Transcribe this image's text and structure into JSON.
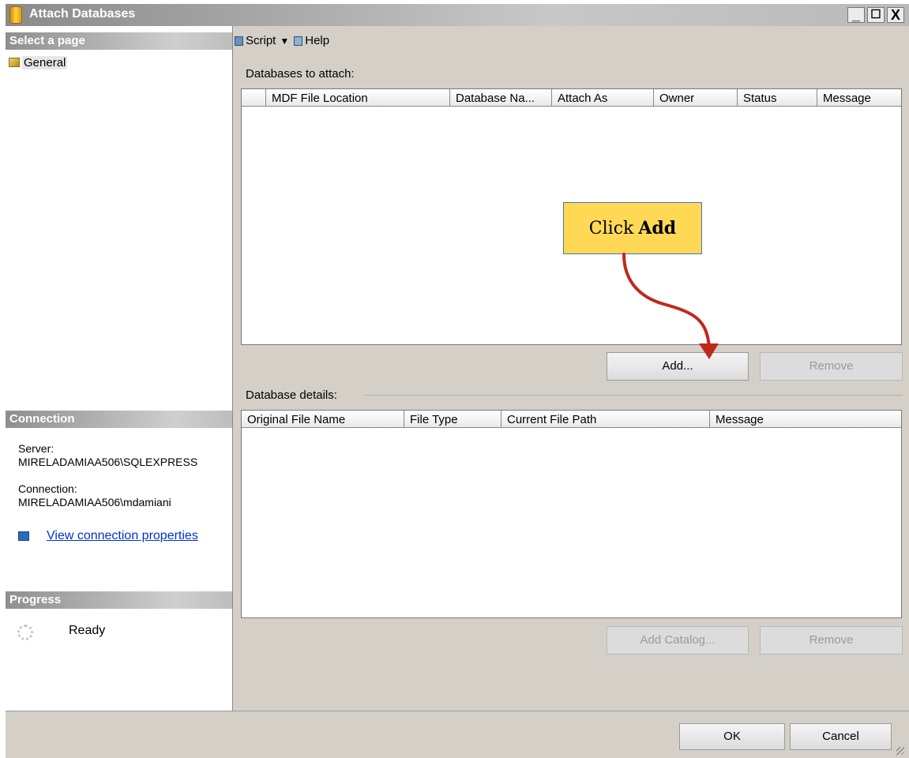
{
  "window": {
    "title": "Attach Databases",
    "minimize": "_",
    "maximize": "☐",
    "close": "X"
  },
  "left": {
    "select_header": "Select a page",
    "nav": [
      {
        "label": "General"
      }
    ],
    "connection_header": "Connection",
    "server_label": "Server:",
    "server_value": "MIRELADAMIAA506\\SQLEXPRESS",
    "connection_label": "Connection:",
    "connection_value": "MIRELADAMIAA506\\mdamiani",
    "view_link": "View connection properties",
    "progress_header": "Progress",
    "progress_status": "Ready"
  },
  "toolbar": {
    "script_label": "Script",
    "script_dropdown": "▼",
    "help_label": "Help"
  },
  "attach": {
    "label": "Databases to attach:",
    "columns": [
      "MDF File Location",
      "Database Na...",
      "Attach As",
      "Owner",
      "Status",
      "Message"
    ],
    "add_button": "Add...",
    "remove_button": "Remove"
  },
  "details": {
    "label": "Database details:",
    "columns": [
      "Original File Name",
      "File Type",
      "Current File Path",
      "Message"
    ],
    "add_catalog_button": "Add Catalog...",
    "remove_button": "Remove"
  },
  "footer": {
    "ok_button": "OK",
    "cancel_button": "Cancel"
  },
  "annotation": {
    "text_plain": "Click",
    "text_bold": "Add",
    "color": "#ffd955",
    "arrow_color": "#c0281c"
  }
}
